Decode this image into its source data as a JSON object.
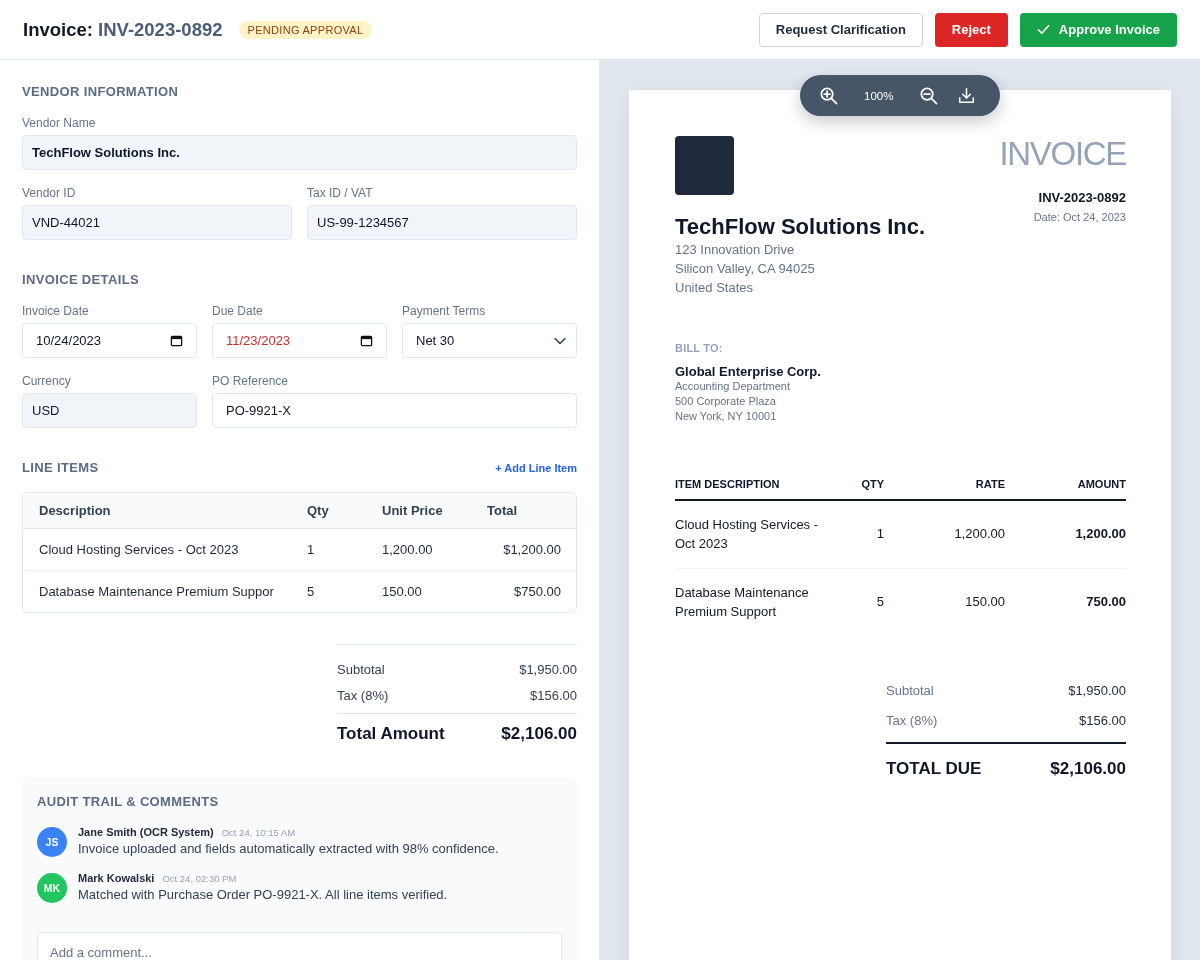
{
  "header": {
    "title_prefix": "Invoice:",
    "title_number": "INV-2023-0892",
    "status": "PENDING APPROVAL",
    "actions": [
      {
        "label": "Request Clarification",
        "kind": "outline"
      },
      {
        "label": "Reject",
        "kind": "danger"
      },
      {
        "label": "Approve Invoice",
        "kind": "success"
      }
    ]
  },
  "form": {
    "sections": [
      {
        "title": "VENDOR INFORMATION",
        "rows": [
          [
            {
              "label": "Vendor Name",
              "value": "TechFlow Solutions Inc.",
              "kind": "text",
              "readonly": true,
              "flagged": false
            }
          ],
          [
            {
              "label": "Vendor ID",
              "value": "VND-44021",
              "kind": "text",
              "readonly": true,
              "flagged": false
            },
            {
              "label": "Tax ID / VAT",
              "value": "US-99-1234567",
              "kind": "text",
              "readonly": true,
              "flagged": false
            }
          ]
        ]
      },
      {
        "title": "INVOICE DETAILS",
        "rows": [
          [
            {
              "label": "Invoice Date",
              "value": "10/24/2023",
              "kind": "date",
              "readonly": false,
              "flagged": false
            },
            {
              "label": "Due Date",
              "value": "11/23/2023",
              "kind": "date",
              "readonly": false,
              "flagged": true
            },
            {
              "label": "Payment Terms",
              "value": "Net 30",
              "kind": "select",
              "readonly": false,
              "flagged": false
            }
          ],
          [
            {
              "label": "Currency",
              "value": "USD",
              "kind": "text",
              "readonly": true,
              "flagged": false
            },
            {
              "label": "PO Reference",
              "value": "PO-9921-X",
              "kind": "text",
              "readonly": false,
              "flagged": false
            }
          ]
        ]
      }
    ]
  },
  "line_items": {
    "title": "LINE ITEMS",
    "add_link": "+ Add Line Item",
    "columns": [
      "Description",
      "Qty",
      "Unit Price",
      "Total"
    ],
    "rows": [
      [
        "Cloud Hosting Services - Oct 2023",
        "1",
        "1,200.00",
        "$1,200.00"
      ],
      [
        "Database Maintenance Premium Suppor",
        "5",
        "150.00",
        "$750.00"
      ]
    ]
  },
  "totals": {
    "rows": [
      {
        "label": "Subtotal",
        "value": "$1,950.00"
      },
      {
        "label": "Tax (8%)",
        "value": "$156.00"
      }
    ],
    "total": {
      "label": "Total Amount",
      "value": "$2,106.00"
    }
  },
  "audit": {
    "title": "AUDIT TRAIL & COMMENTS",
    "comments": [
      {
        "initials": "JS",
        "color": "#3b82f6",
        "author": "Jane Smith (OCR System)",
        "time": "Oct 24, 10:15 AM",
        "text": "Invoice uploaded and fields automatically extracted with 98% confidence."
      },
      {
        "initials": "MK",
        "color": "#22c55e",
        "author": "Mark Kowalski",
        "time": "Oct 24, 02:30 PM",
        "text": "Matched with Purchase Order PO-9921-X. All line items verified."
      }
    ],
    "comment_placeholder": "Add a comment..."
  },
  "viewer": {
    "zoom_level": "100%",
    "document": {
      "title": "INVOICE",
      "number": "INV-2023-0892",
      "date": "Date: Oct 24, 2023",
      "vendor": {
        "name": "TechFlow Solutions Inc.",
        "address": [
          "123 Innovation Drive",
          "Silicon Valley, CA 94025",
          "United States"
        ]
      },
      "bill_to": {
        "heading": "BILL TO:",
        "name": "Global Enterprise Corp.",
        "address": [
          "Accounting Department",
          "500 Corporate Plaza",
          "New York, NY 10001"
        ]
      },
      "columns": [
        "ITEM DESCRIPTION",
        "QTY",
        "RATE",
        "AMOUNT"
      ],
      "rows": [
        [
          "Cloud Hosting Services - Oct 2023",
          "1",
          "1,200.00",
          "1,200.00"
        ],
        [
          "Database Maintenance Premium Support",
          "5",
          "150.00",
          "750.00"
        ]
      ],
      "totals": [
        {
          "label": "Subtotal",
          "value": "$1,950.00"
        },
        {
          "label": "Tax (8%)",
          "value": "$156.00"
        }
      ],
      "total": {
        "label": "TOTAL DUE",
        "value": "$2,106.00"
      }
    }
  }
}
